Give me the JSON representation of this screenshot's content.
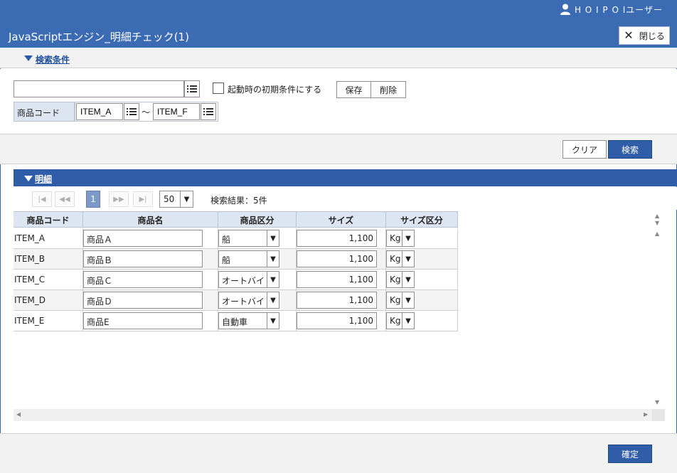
{
  "window": {
    "user_label": "H O I P O Iユーザー",
    "title": "JavaScriptエンジン_明細チェック(1)",
    "close_label": "閉じる"
  },
  "search_section": {
    "title": "検索条件",
    "condition_input_value": "",
    "checkbox_label": "起動時の初期条件にする",
    "checkbox_checked": false,
    "save_label": "保存",
    "delete_label": "削除",
    "field_label": "商品コード",
    "range_from": "ITEM_A",
    "range_separator": "～",
    "range_to": "ITEM_F"
  },
  "actions": {
    "clear_label": "クリア",
    "search_label": "検索"
  },
  "detail_section": {
    "title": "明細",
    "pager": {
      "first_icon": "first-page-icon",
      "prev_icon": "prev-page-icon",
      "current_page": "1",
      "next_icon": "next-page-icon",
      "last_icon": "last-page-icon",
      "page_size": "50",
      "result_text": "検索結果：5件"
    },
    "columns": [
      "商品コード",
      "商品名",
      "商品区分",
      "サイズ",
      "サイズ区分"
    ],
    "rows": [
      {
        "code": "ITEM_A",
        "name": "商品Ａ",
        "category": "船",
        "size": "1,100",
        "unit": "Kg"
      },
      {
        "code": "ITEM_B",
        "name": "商品Ｂ",
        "category": "船",
        "size": "1,100",
        "unit": "Kg"
      },
      {
        "code": "ITEM_C",
        "name": "商品Ｃ",
        "category": "オートバイ",
        "size": "1,100",
        "unit": "Kg"
      },
      {
        "code": "ITEM_D",
        "name": "商品Ｄ",
        "category": "オートバイ",
        "size": "1,100",
        "unit": "Kg"
      },
      {
        "code": "ITEM_E",
        "name": "商品E",
        "category": "自動車",
        "size": "1,100",
        "unit": "Kg"
      }
    ]
  },
  "footer": {
    "confirm_label": "確定"
  },
  "colors": {
    "header_blue": "#3b6bb3",
    "button_blue": "#2f5da8",
    "grid_header": "#dde5f1"
  }
}
